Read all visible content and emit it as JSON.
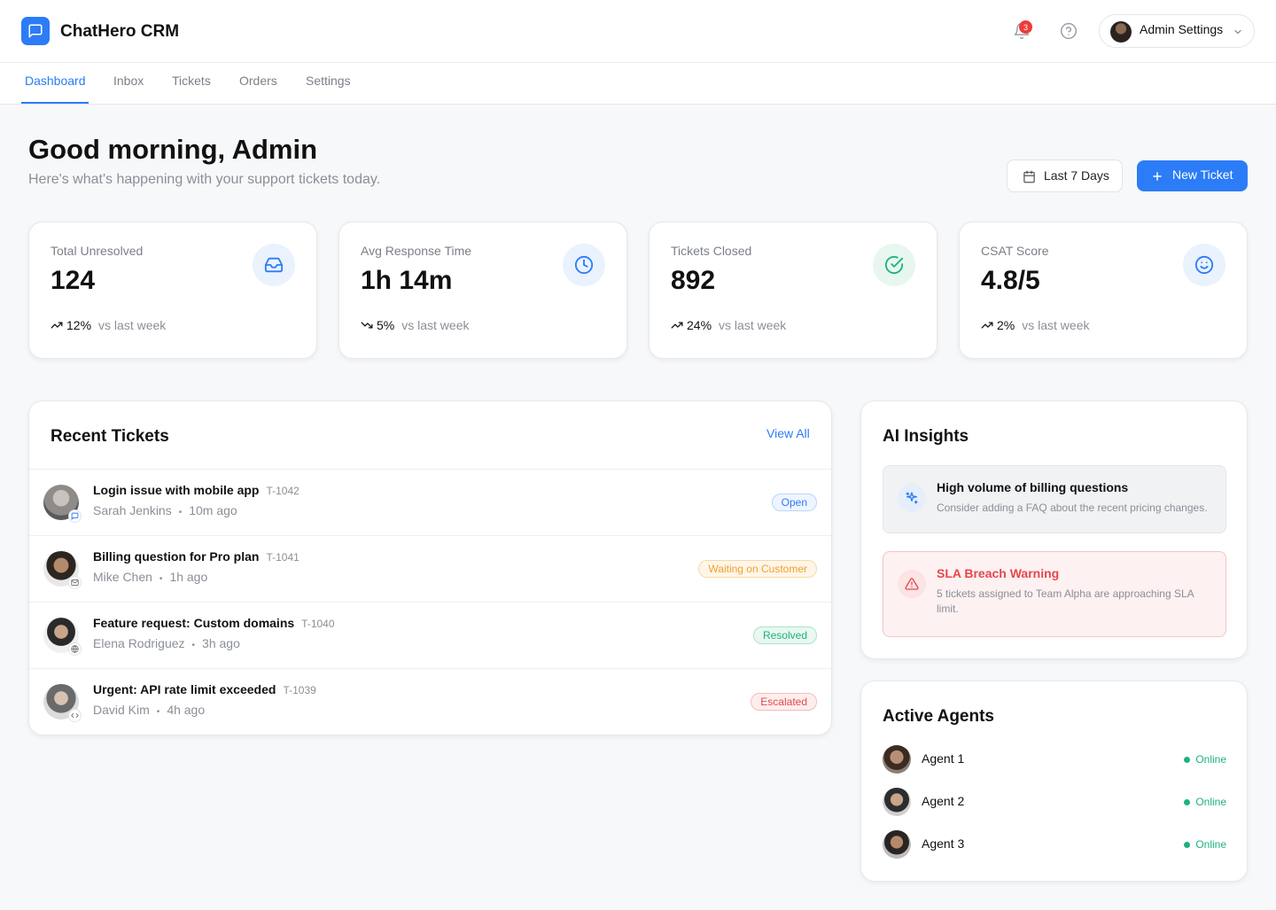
{
  "app": {
    "name": "ChatHero CRM",
    "notification_count": "3",
    "admin_label": "Admin Settings"
  },
  "nav": {
    "tabs": [
      "Dashboard",
      "Inbox",
      "Tickets",
      "Orders",
      "Settings"
    ],
    "active": "Dashboard"
  },
  "greeting": {
    "title": "Good morning, Admin",
    "subtitle": "Here's what's happening with your support tickets today."
  },
  "actions": {
    "range_label": "Last 7 Days",
    "new_ticket_label": "New Ticket"
  },
  "stats": [
    {
      "label": "Total Unresolved",
      "value": "124",
      "change": "12%",
      "direction": "up",
      "compare": "vs last week",
      "icon": "inbox-icon",
      "icon_color": "#2b7cf6",
      "icon_bg": "#eaf2fe"
    },
    {
      "label": "Avg Response Time",
      "value": "1h 14m",
      "change": "5%",
      "direction": "down",
      "compare": "vs last week",
      "icon": "clock-icon",
      "icon_color": "#2b7cf6",
      "icon_bg": "#eaf2fe"
    },
    {
      "label": "Tickets Closed",
      "value": "892",
      "change": "24%",
      "direction": "up",
      "compare": "vs last week",
      "icon": "check-circle-icon",
      "icon_color": "#1db37a",
      "icon_bg": "#e7f7ef"
    },
    {
      "label": "CSAT Score",
      "value": "4.8/5",
      "change": "2%",
      "direction": "up",
      "compare": "vs last week",
      "icon": "smile-icon",
      "icon_color": "#2b7cf6",
      "icon_bg": "#eaf2fe"
    }
  ],
  "recent": {
    "title": "Recent Tickets",
    "view_all": "View All",
    "tickets": [
      {
        "title": "Login issue with mobile app",
        "id": "T-1042",
        "customer": "Sarah Jenkins",
        "time": "10m ago",
        "status": "Open",
        "status_color": "#2b7cf6",
        "status_bg": "#eef5ff",
        "channel": "chat-icon"
      },
      {
        "title": "Billing question for Pro plan",
        "id": "T-1041",
        "customer": "Mike Chen",
        "time": "1h ago",
        "status": "Waiting on Customer",
        "status_color": "#f0a030",
        "status_bg": "#fff6e8",
        "channel": "mail-icon"
      },
      {
        "title": "Feature request: Custom domains",
        "id": "T-1040",
        "customer": "Elena Rodriguez",
        "time": "3h ago",
        "status": "Resolved",
        "status_color": "#1db37a",
        "status_bg": "#e9f8f1",
        "channel": "globe-icon"
      },
      {
        "title": "Urgent: API rate limit exceeded",
        "id": "T-1039",
        "customer": "David Kim",
        "time": "4h ago",
        "status": "Escalated",
        "status_color": "#e5484d",
        "status_bg": "#fdeeee",
        "channel": "code-icon"
      }
    ]
  },
  "insights": {
    "title": "AI Insights",
    "items": [
      {
        "title": "High volume of billing questions",
        "desc": "Consider adding a FAQ about the recent pricing changes.",
        "icon": "sparkles-icon"
      },
      {
        "title": "SLA Breach Warning",
        "desc": "5 tickets assigned to Team Alpha are approaching SLA limit.",
        "icon": "warning-icon"
      }
    ]
  },
  "agents": {
    "title": "Active Agents",
    "list": [
      {
        "name": "Agent 1",
        "status": "Online"
      },
      {
        "name": "Agent 2",
        "status": "Online"
      },
      {
        "name": "Agent 3",
        "status": "Online"
      }
    ]
  }
}
